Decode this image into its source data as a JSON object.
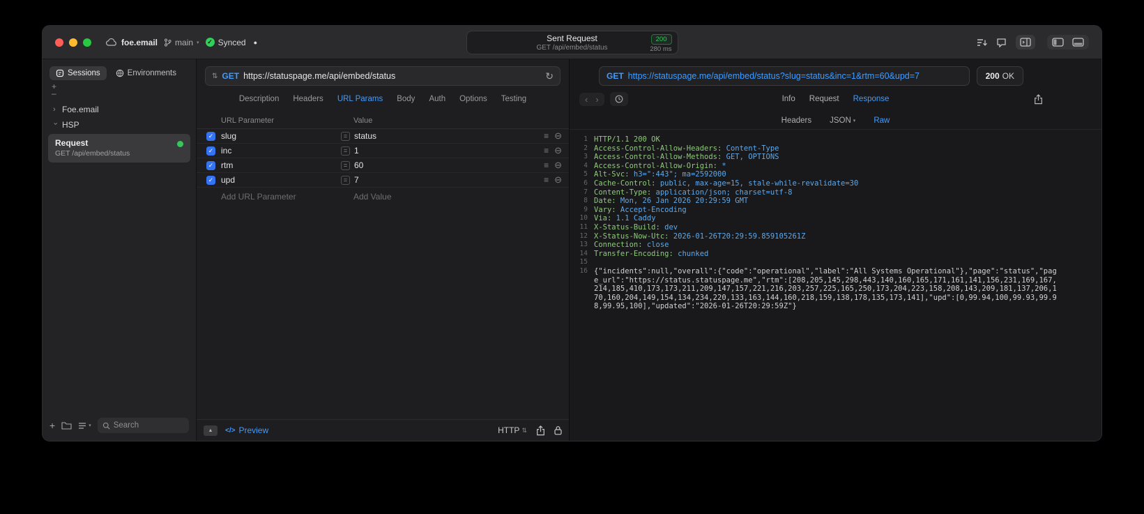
{
  "colors": {
    "accent": "#409cff",
    "success-green": "#30d158",
    "header-name-green": "#8fc97c",
    "header-value-blue": "#5fa8e8",
    "checkbox-blue": "#3573f5"
  },
  "titlebar": {
    "project": "foe.email",
    "branch": "main",
    "sync_status": "Synced",
    "request_title": "Sent Request",
    "request_subtitle": "GET /api/embed/status",
    "status_code": "200",
    "duration": "280 ms"
  },
  "sidebar": {
    "tabs": {
      "sessions": "Sessions",
      "environments": "Environments"
    },
    "tree": {
      "item1": "Foe.email",
      "item2": "HSP"
    },
    "selected_request": {
      "name": "Request",
      "subtitle": "GET /api/embed/status"
    },
    "search_placeholder": "Search"
  },
  "request_panel": {
    "method": "GET",
    "url": "https://statuspage.me/api/embed/status",
    "tabs": {
      "t1": "Description",
      "t2": "Headers",
      "t3": "URL Params",
      "t4": "Body",
      "t5": "Auth",
      "t6": "Options",
      "t7": "Testing"
    },
    "active_tab": "URL Params",
    "table": {
      "col_param": "URL Parameter",
      "col_value": "Value",
      "rows": [
        {
          "name": "slug",
          "value": "status",
          "checked": true
        },
        {
          "name": "inc",
          "value": "1",
          "checked": true
        },
        {
          "name": "rtm",
          "value": "60",
          "checked": true
        },
        {
          "name": "upd",
          "value": "7",
          "checked": true
        }
      ],
      "add_param_placeholder": "Add URL Parameter",
      "add_value_placeholder": "Add Value"
    },
    "footer": {
      "preview_label": "Preview",
      "code_icon": "</>",
      "http_label": "HTTP"
    }
  },
  "response_panel": {
    "method": "GET",
    "url": "https://statuspage.me/api/embed/status?slug=status&inc=1&rtm=60&upd=7",
    "status_code": "200",
    "status_text": "OK",
    "tabs": {
      "t1": "Info",
      "t2": "Request",
      "t3": "Response"
    },
    "active_tab": "Response",
    "subtabs": {
      "s1": "Headers",
      "s2": "JSON",
      "s3": "Raw"
    },
    "active_subtab": "Raw",
    "lines": [
      {
        "num": "1",
        "name": "HTTP/1.1 200 OK",
        "value": ""
      },
      {
        "num": "2",
        "name": "Access-Control-Allow-Headers:",
        "value": "Content-Type"
      },
      {
        "num": "3",
        "name": "Access-Control-Allow-Methods:",
        "value": "GET, OPTIONS"
      },
      {
        "num": "4",
        "name": "Access-Control-Allow-Origin:",
        "value": "*"
      },
      {
        "num": "5",
        "name": "Alt-Svc:",
        "value": "h3=\":443\"; ma=2592000"
      },
      {
        "num": "6",
        "name": "Cache-Control:",
        "value": "public, max-age=15, stale-while-revalidate=30"
      },
      {
        "num": "7",
        "name": "Content-Type:",
        "value": "application/json; charset=utf-8"
      },
      {
        "num": "8",
        "name": "Date:",
        "value": "Mon, 26 Jan 2026 20:29:59 GMT"
      },
      {
        "num": "9",
        "name": "Vary:",
        "value": "Accept-Encoding"
      },
      {
        "num": "10",
        "name": "Via:",
        "value": "1.1 Caddy"
      },
      {
        "num": "11",
        "name": "X-Status-Build:",
        "value": "dev"
      },
      {
        "num": "12",
        "name": "X-Status-Now-Utc:",
        "value": "2026-01-26T20:29:59.859105261Z"
      },
      {
        "num": "13",
        "name": "Connection:",
        "value": "close"
      },
      {
        "num": "14",
        "name": "Transfer-Encoding:",
        "value": "chunked"
      },
      {
        "num": "15",
        "name": "",
        "value": ""
      }
    ],
    "body_line_num": "16",
    "body": "{\"incidents\":null,\"overall\":{\"code\":\"operational\",\"label\":\"All Systems Operational\"},\"page\":\"status\",\"page_url\":\"https://status.statuspage.me\",\"rtm\":[208,205,145,298,443,140,160,165,171,161,141,156,231,169,167,214,185,410,173,173,211,209,147,157,221,216,203,257,225,165,250,173,204,223,158,208,143,209,181,137,206,170,160,204,149,154,134,234,220,133,163,144,160,218,159,138,178,135,173,141],\"upd\":[0,99.94,100,99.93,99.98,99.95,100],\"updated\":\"2026-01-26T20:29:59Z\"}"
  }
}
